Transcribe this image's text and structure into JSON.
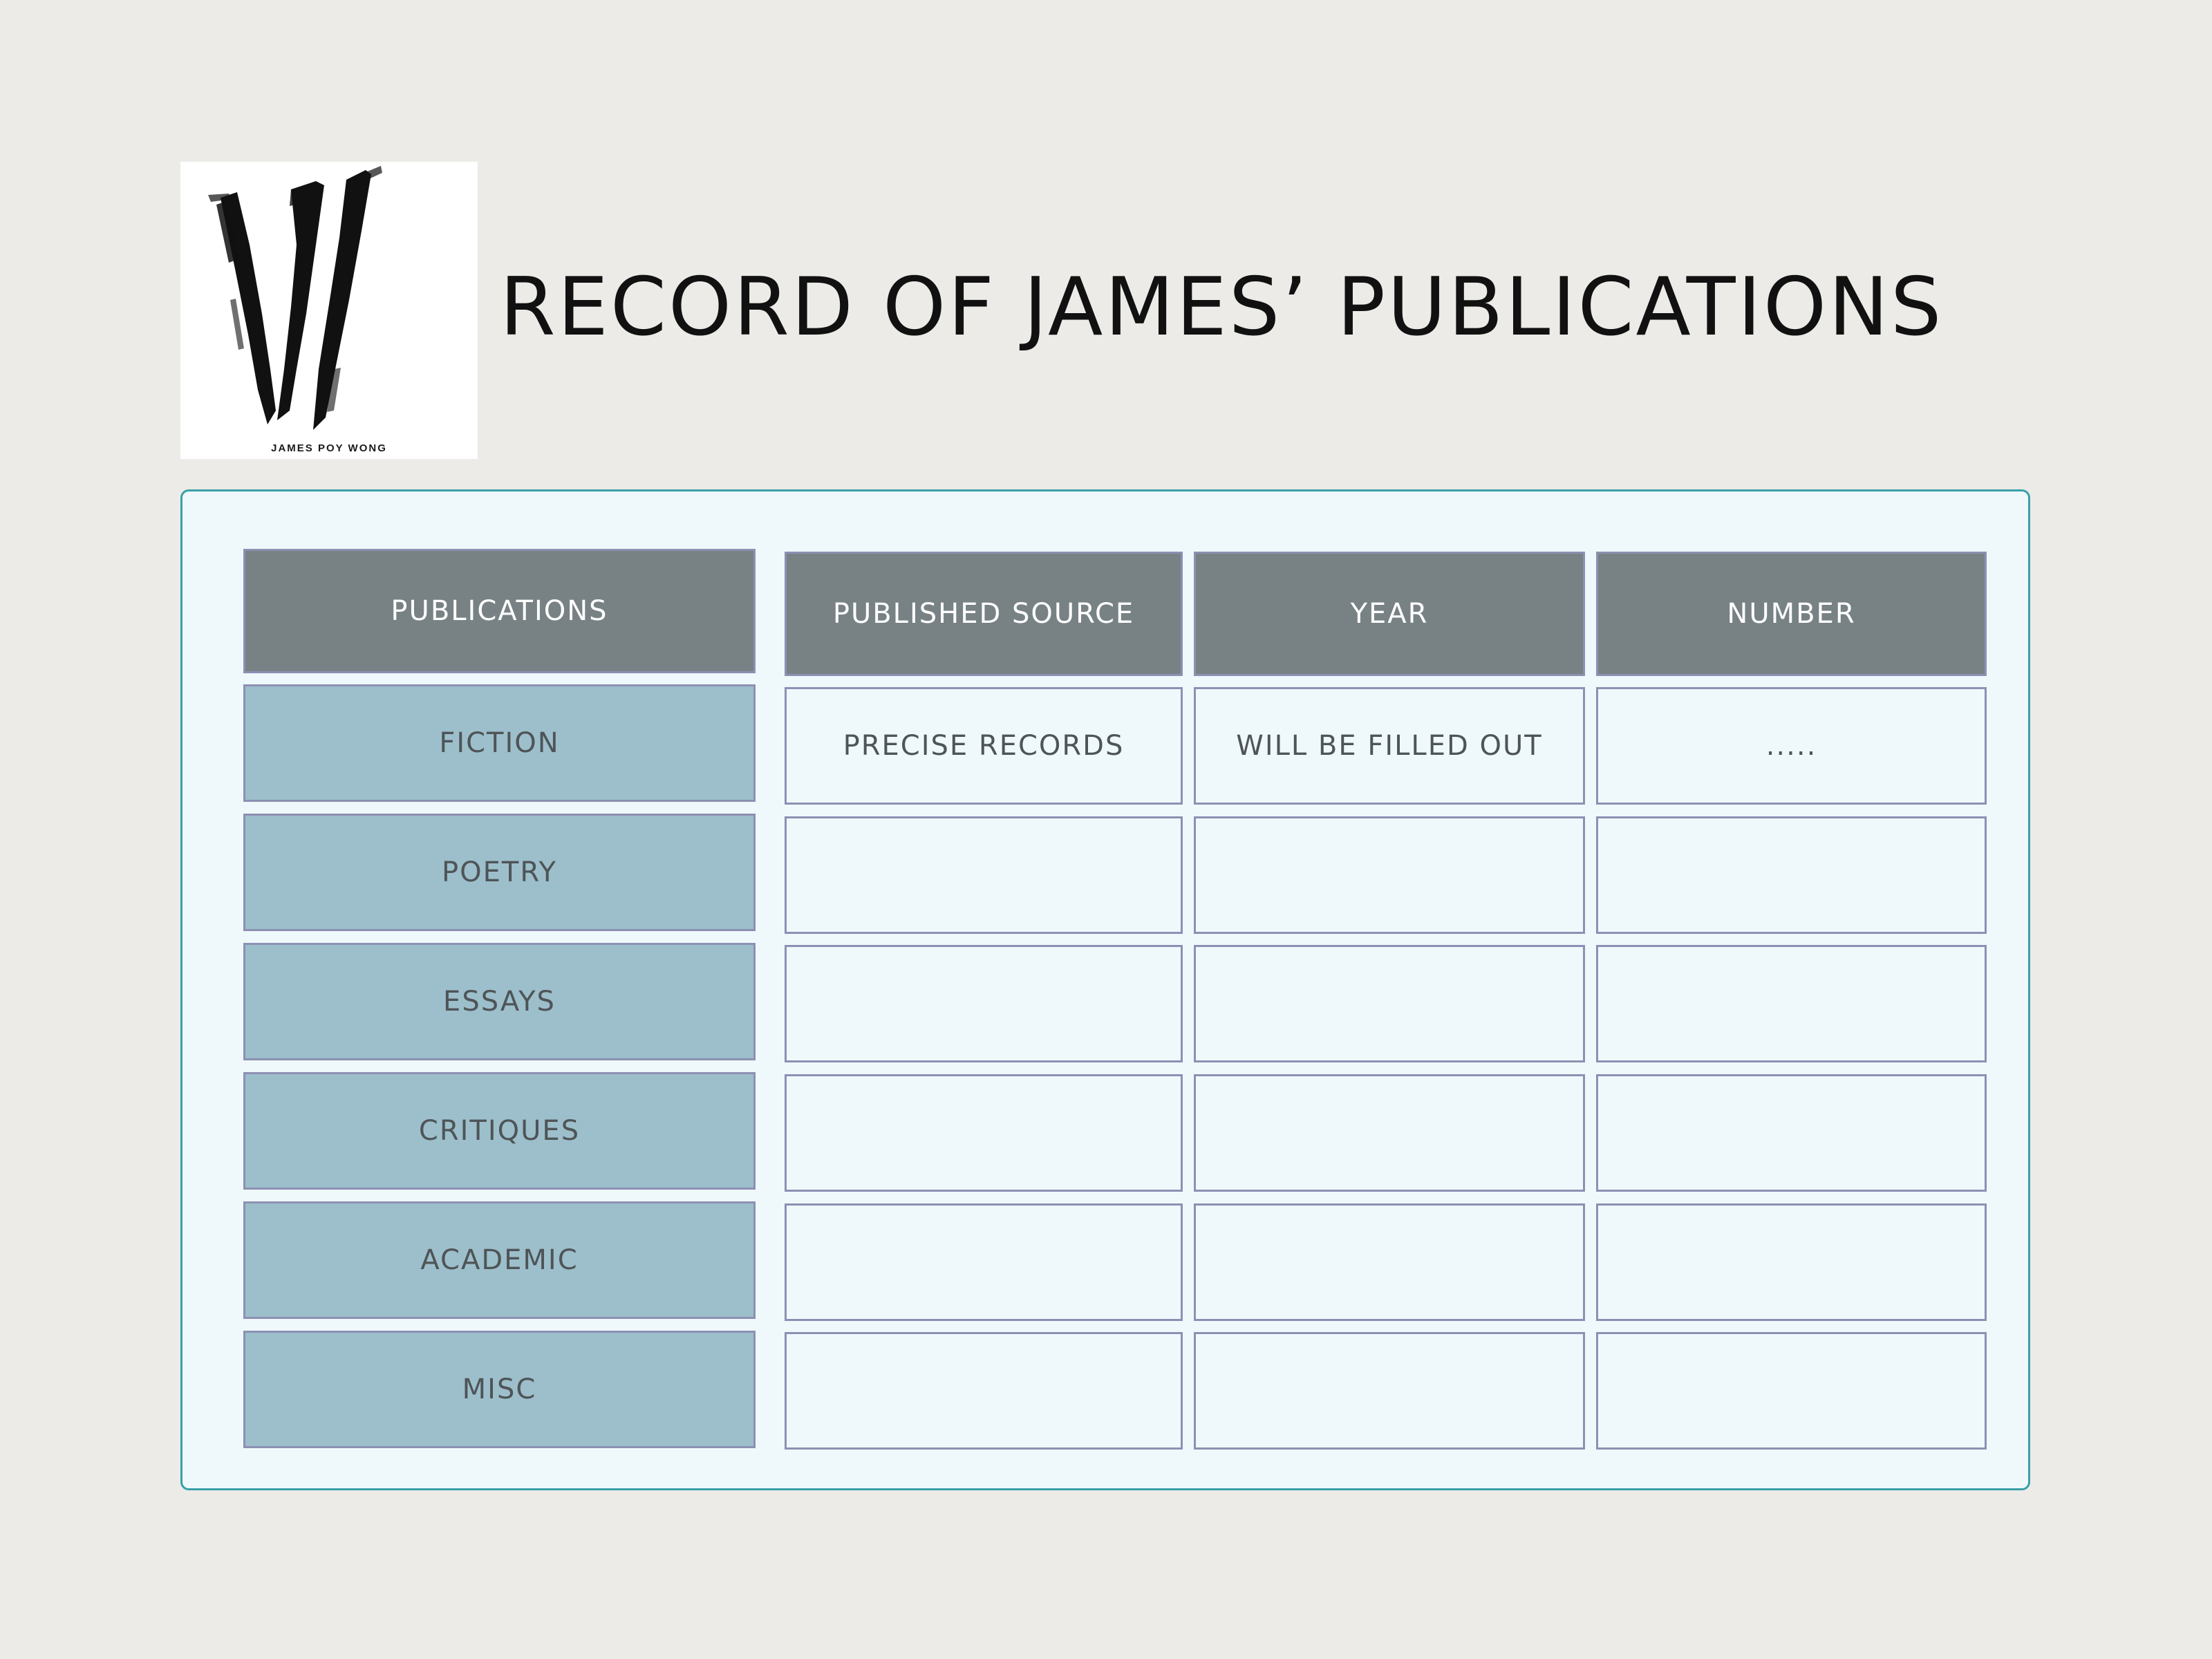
{
  "logo": {
    "caption": "JAMES POY WONG"
  },
  "title": "RECORD OF JAMES’ PUBLICATIONS",
  "table": {
    "headers": [
      "PUBLICATIONS",
      "PUBLISHED SOURCE",
      "YEAR",
      "NUMBER"
    ],
    "rows": [
      {
        "category": "FICTION",
        "source": "PRECISE RECORDS",
        "year": "WILL BE FILLED OUT",
        "number": "....."
      },
      {
        "category": "POETRY",
        "source": "",
        "year": "",
        "number": ""
      },
      {
        "category": "ESSAYS",
        "source": "",
        "year": "",
        "number": ""
      },
      {
        "category": "CRITIQUES",
        "source": "",
        "year": "",
        "number": ""
      },
      {
        "category": "ACADEMIC",
        "source": "",
        "year": "",
        "number": ""
      },
      {
        "category": "MISC",
        "source": "",
        "year": "",
        "number": ""
      }
    ]
  },
  "colors": {
    "background": "#ecebe7",
    "panel": "#eff9fc",
    "panel_border": "#3aa0a8",
    "header_fill": "#788285",
    "category_fill": "#9cbfcb",
    "cell_border": "#8d90b2"
  }
}
